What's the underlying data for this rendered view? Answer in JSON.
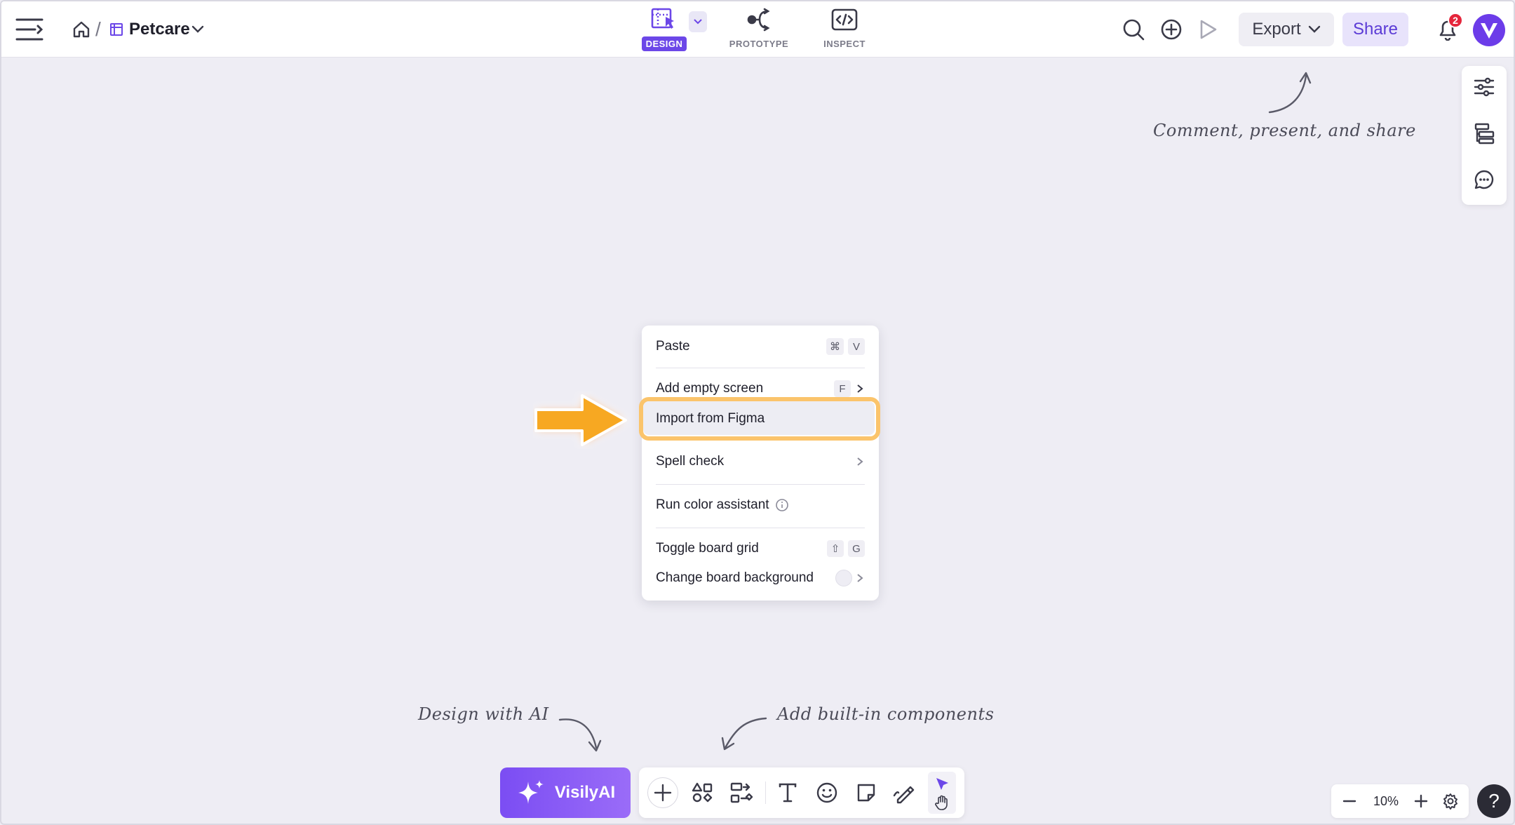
{
  "header": {
    "project_name": "Petcare",
    "crumb_separator": "/",
    "modes": [
      {
        "label": "DESIGN",
        "active": true
      },
      {
        "label": "PROTOTYPE",
        "active": false
      },
      {
        "label": "INSPECT",
        "active": false
      }
    ],
    "export_label": "Export",
    "share_label": "Share",
    "notification_count": "2"
  },
  "annotations": {
    "comment": "Comment, present, and share",
    "design_ai": "Design with AI",
    "components": "Add built-in components"
  },
  "context_menu": {
    "paste": {
      "label": "Paste",
      "keys": [
        "⌘",
        "V"
      ]
    },
    "add_screen": {
      "label": "Add empty screen",
      "keys": [
        "F"
      ]
    },
    "import_figma": {
      "label": "Import from Figma"
    },
    "spell_check": {
      "label": "Spell check"
    },
    "color_assistant": {
      "label": "Run color assistant"
    },
    "toggle_grid": {
      "label": "Toggle board grid",
      "keys": [
        "⇧",
        "G"
      ]
    },
    "change_bg": {
      "label": "Change board background"
    }
  },
  "toolbar": {
    "ai_label": "VisilyAI"
  },
  "zoom": {
    "level": "10%"
  },
  "help_label": "?",
  "colors": {
    "accent": "#6C47E8",
    "highlight": "#FBC46B",
    "arrow": "#F7A823",
    "badge": "#E5253B",
    "canvas": "#EEEDF4"
  }
}
